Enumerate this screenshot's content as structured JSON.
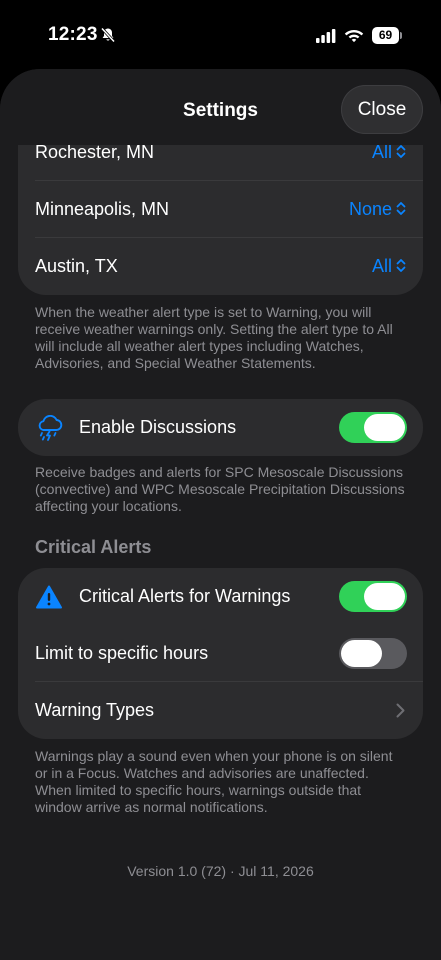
{
  "status_bar": {
    "time": "12:23",
    "battery": "69",
    "icons": [
      "bell-slash-icon",
      "cellular-signal-icon",
      "wifi-icon",
      "battery-icon"
    ]
  },
  "nav": {
    "title": "Settings",
    "close_label": "Close"
  },
  "locations": {
    "items": [
      {
        "name": "Rochester, MN",
        "alert_type": "All"
      },
      {
        "name": "Minneapolis, MN",
        "alert_type": "None"
      },
      {
        "name": "Austin, TX",
        "alert_type": "All"
      }
    ],
    "footer": "When the weather alert type is set to Warning, you will receive weather warnings only. Setting the alert type to All will include all weather alert types including Watches, Advisories, and Special Weather Statements."
  },
  "discussions": {
    "label": "Enable Discussions",
    "enabled": true,
    "footer": "Receive badges and alerts for SPC Mesoscale Discussions (convective) and WPC Mesoscale Precipitation Discussions affecting your locations."
  },
  "critical_alerts": {
    "header": "Critical Alerts",
    "warnings_label": "Critical Alerts for Warnings",
    "warnings_enabled": true,
    "limit_label": "Limit to specific hours",
    "limit_enabled": false,
    "warning_types_label": "Warning Types",
    "footer": "Warnings play a sound even when your phone is on silent or in a Focus. Watches and advisories are unaffected. When limited to specific hours, warnings outside that window arrive as normal notifications."
  },
  "version": "Version 1.0 (72) · Jul 11, 2026",
  "colors": {
    "accent": "#0a84ff",
    "toggle_on": "#30d158",
    "warning_icon": "#0a84ff",
    "background": "#1c1c1e",
    "group": "#2c2c2e"
  }
}
